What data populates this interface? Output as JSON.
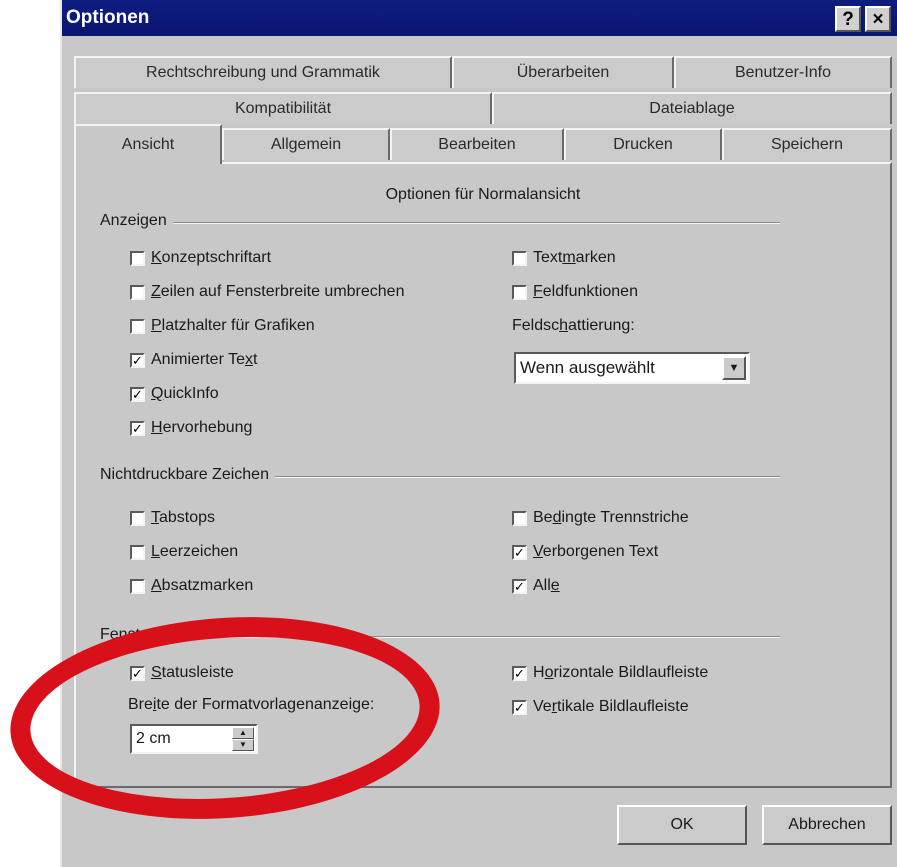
{
  "window": {
    "title": "Optionen",
    "help_glyph": "?",
    "close_glyph": "×"
  },
  "tabs": {
    "row1": [
      "Rechtschreibung und Grammatik",
      "Überarbeiten",
      "Benutzer-Info"
    ],
    "row2": [
      "Kompatibilität",
      "Dateiablage"
    ],
    "row3": [
      "Ansicht",
      "Allgemein",
      "Bearbeiten",
      "Drucken",
      "Speichern"
    ],
    "active": "Ansicht"
  },
  "panel": {
    "heading": "Optionen für Normalansicht",
    "anzeigen": {
      "label": "Anzeigen",
      "left": [
        {
          "pre": "",
          "u": "K",
          "post": "onzeptschriftart",
          "checked": false
        },
        {
          "pre": "",
          "u": "Z",
          "post": "eilen auf Fensterbreite umbrechen",
          "checked": false
        },
        {
          "pre": "",
          "u": "P",
          "post": "latzhalter für Grafiken",
          "checked": false
        },
        {
          "pre": "Animierter Te",
          "u": "x",
          "post": "t",
          "checked": true
        },
        {
          "pre": "",
          "u": "Q",
          "post": "uickInfo",
          "checked": true
        },
        {
          "pre": "",
          "u": "H",
          "post": "ervorhebung",
          "checked": true
        }
      ],
      "right": [
        {
          "pre": "Text",
          "u": "m",
          "post": "arken",
          "checked": false
        },
        {
          "pre": "",
          "u": "F",
          "post": "eldfunktionen",
          "checked": false
        }
      ],
      "shading_label_pre": "Feldsc",
      "shading_label_u": "h",
      "shading_label_post": "attierung:",
      "shading_value": "Wenn ausgewählt",
      "dropdown_glyph": "▼"
    },
    "nichtdruckbare": {
      "label": "Nichtdruckbare Zeichen",
      "left": [
        {
          "pre": "",
          "u": "T",
          "post": "abstops",
          "checked": false
        },
        {
          "pre": "",
          "u": "L",
          "post": "eerzeichen",
          "checked": false
        },
        {
          "pre": "",
          "u": "A",
          "post": "bsatzmarken",
          "checked": false
        }
      ],
      "right": [
        {
          "pre": "Be",
          "u": "d",
          "post": "ingte Trennstriche",
          "checked": false
        },
        {
          "pre": "",
          "u": "V",
          "post": "erborgenen Text",
          "checked": true
        },
        {
          "pre": "All",
          "u": "e",
          "post": "",
          "checked": true
        }
      ]
    },
    "fenster": {
      "label": "Fenster",
      "left": [
        {
          "pre": "",
          "u": "S",
          "post": "tatusleiste",
          "checked": true
        }
      ],
      "right": [
        {
          "pre": "H",
          "u": "o",
          "post": "rizontale Bildlaufleiste",
          "checked": true
        },
        {
          "pre": "Ve",
          "u": "r",
          "post": "tikale Bildlaufleiste",
          "checked": true
        }
      ],
      "width_label_pre": "Bre",
      "width_label_u": "i",
      "width_label_post": "te der Formatvorlagenanzeige:",
      "width_value": "2 cm",
      "spin_up": "▲",
      "spin_down": "▼"
    }
  },
  "buttons": {
    "ok": "OK",
    "cancel": "Abbrechen"
  },
  "check_glyph": "✓",
  "annotation_color": "#d8101a"
}
